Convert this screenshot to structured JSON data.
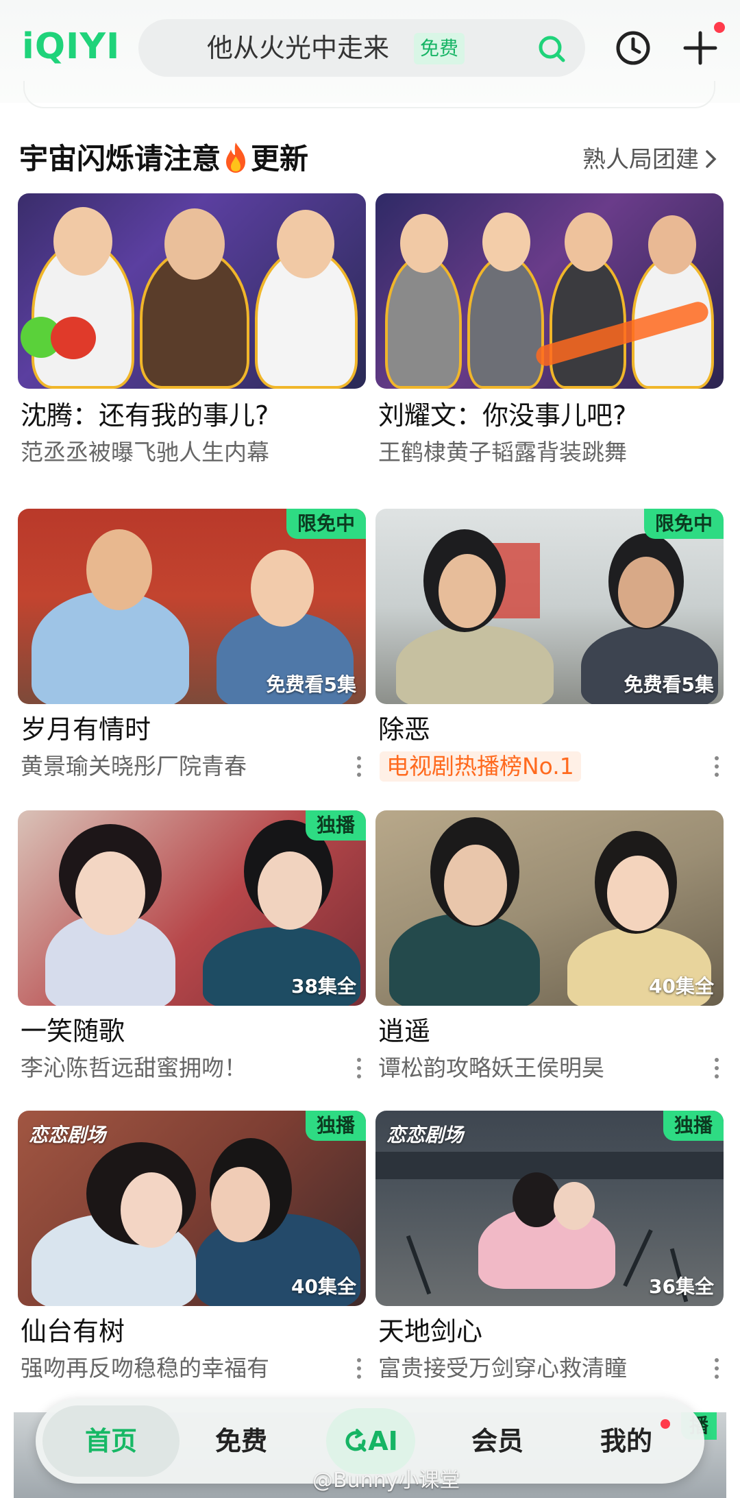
{
  "header": {
    "logo": "iQIYI",
    "search_text": "他从火光中走来",
    "search_tag": "免费",
    "brand_color": "#1fd37a"
  },
  "section": {
    "title_part1": "宇宙闪烁请注意",
    "title_part2": "更新",
    "more_label": "熟人局团建"
  },
  "cards": [
    {
      "title": "沈腾：还有我的事儿?",
      "subtitle": "范丞丞被曝飞驰人生内幕",
      "badge": "",
      "count": "",
      "studio": ""
    },
    {
      "title": "刘耀文：你没事儿吧?",
      "subtitle": "王鹤棣黄子韬露背装跳舞",
      "badge": "",
      "count": "",
      "studio": ""
    },
    {
      "title": "岁月有情时",
      "subtitle": "黄景瑜关晓彤厂院青春",
      "badge": "限免中",
      "count": "免费看5集",
      "studio": ""
    },
    {
      "title": "除恶",
      "subtitle": "电视剧热播榜No.1",
      "badge": "限免中",
      "count": "免费看5集",
      "studio": ""
    },
    {
      "title": "一笑随歌",
      "subtitle": "李沁陈哲远甜蜜拥吻！",
      "badge": "独播",
      "count": "38集全",
      "studio": ""
    },
    {
      "title": "逍遥",
      "subtitle": "谭松韵攻略妖王侯明昊",
      "badge": "",
      "count": "40集全",
      "studio": ""
    },
    {
      "title": "仙台有树",
      "subtitle": "强吻再反吻稳稳的幸福有",
      "badge": "独播",
      "count": "40集全",
      "studio": "恋恋剧场"
    },
    {
      "title": "天地剑心",
      "subtitle": "富贵接受万剑穿心救清瞳",
      "badge": "独播",
      "count": "36集全",
      "studio": "恋恋剧场"
    }
  ],
  "nav": {
    "home": "首页",
    "free": "免费",
    "ai": "AI",
    "vip": "会员",
    "mine": "我的",
    "peek_badge": "播"
  },
  "watermark": "@Bunny小课堂"
}
